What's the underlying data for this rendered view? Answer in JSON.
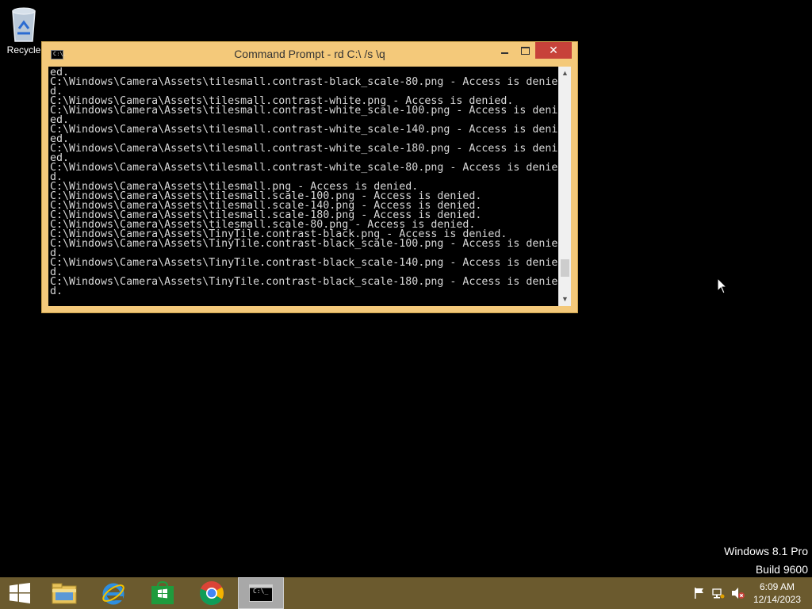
{
  "desktop": {
    "recycle_bin_label": "Recycle",
    "watermark": {
      "line1": "Windows 8.1 Pro",
      "line2": "Build 9600"
    }
  },
  "window": {
    "title": "Command Prompt - rd  C:\\ /s \\q",
    "icon_text": "C:\\.",
    "close_glyph": "✕",
    "console_lines": [
      "ed.",
      "C:\\Windows\\Camera\\Assets\\tilesmall.contrast-black_scale-80.png - Access is denie",
      "d.",
      "C:\\Windows\\Camera\\Assets\\tilesmall.contrast-white.png - Access is denied.",
      "C:\\Windows\\Camera\\Assets\\tilesmall.contrast-white_scale-100.png - Access is deni",
      "ed.",
      "C:\\Windows\\Camera\\Assets\\tilesmall.contrast-white_scale-140.png - Access is deni",
      "ed.",
      "C:\\Windows\\Camera\\Assets\\tilesmall.contrast-white_scale-180.png - Access is deni",
      "ed.",
      "C:\\Windows\\Camera\\Assets\\tilesmall.contrast-white_scale-80.png - Access is denie",
      "d.",
      "C:\\Windows\\Camera\\Assets\\tilesmall.png - Access is denied.",
      "C:\\Windows\\Camera\\Assets\\tilesmall.scale-100.png - Access is denied.",
      "C:\\Windows\\Camera\\Assets\\tilesmall.scale-140.png - Access is denied.",
      "C:\\Windows\\Camera\\Assets\\tilesmall.scale-180.png - Access is denied.",
      "C:\\Windows\\Camera\\Assets\\tilesmall.scale-80.png - Access is denied.",
      "C:\\Windows\\Camera\\Assets\\TinyTile.contrast-black.png - Access is denied.",
      "C:\\Windows\\Camera\\Assets\\TinyTile.contrast-black_scale-100.png - Access is denie",
      "d.",
      "C:\\Windows\\Camera\\Assets\\TinyTile.contrast-black_scale-140.png - Access is denie",
      "d.",
      "C:\\Windows\\Camera\\Assets\\TinyTile.contrast-black_scale-180.png - Access is denie",
      "d."
    ],
    "scroll_position": 0.92
  },
  "taskbar": {
    "cmd_icon_text": "C:\\_",
    "clock": {
      "time": "6:09 AM",
      "date": "12/14/2023"
    },
    "colors": {
      "taskbar": "#6b5a2e",
      "window_frame": "#f4c97a",
      "close": "#c7423a"
    }
  }
}
